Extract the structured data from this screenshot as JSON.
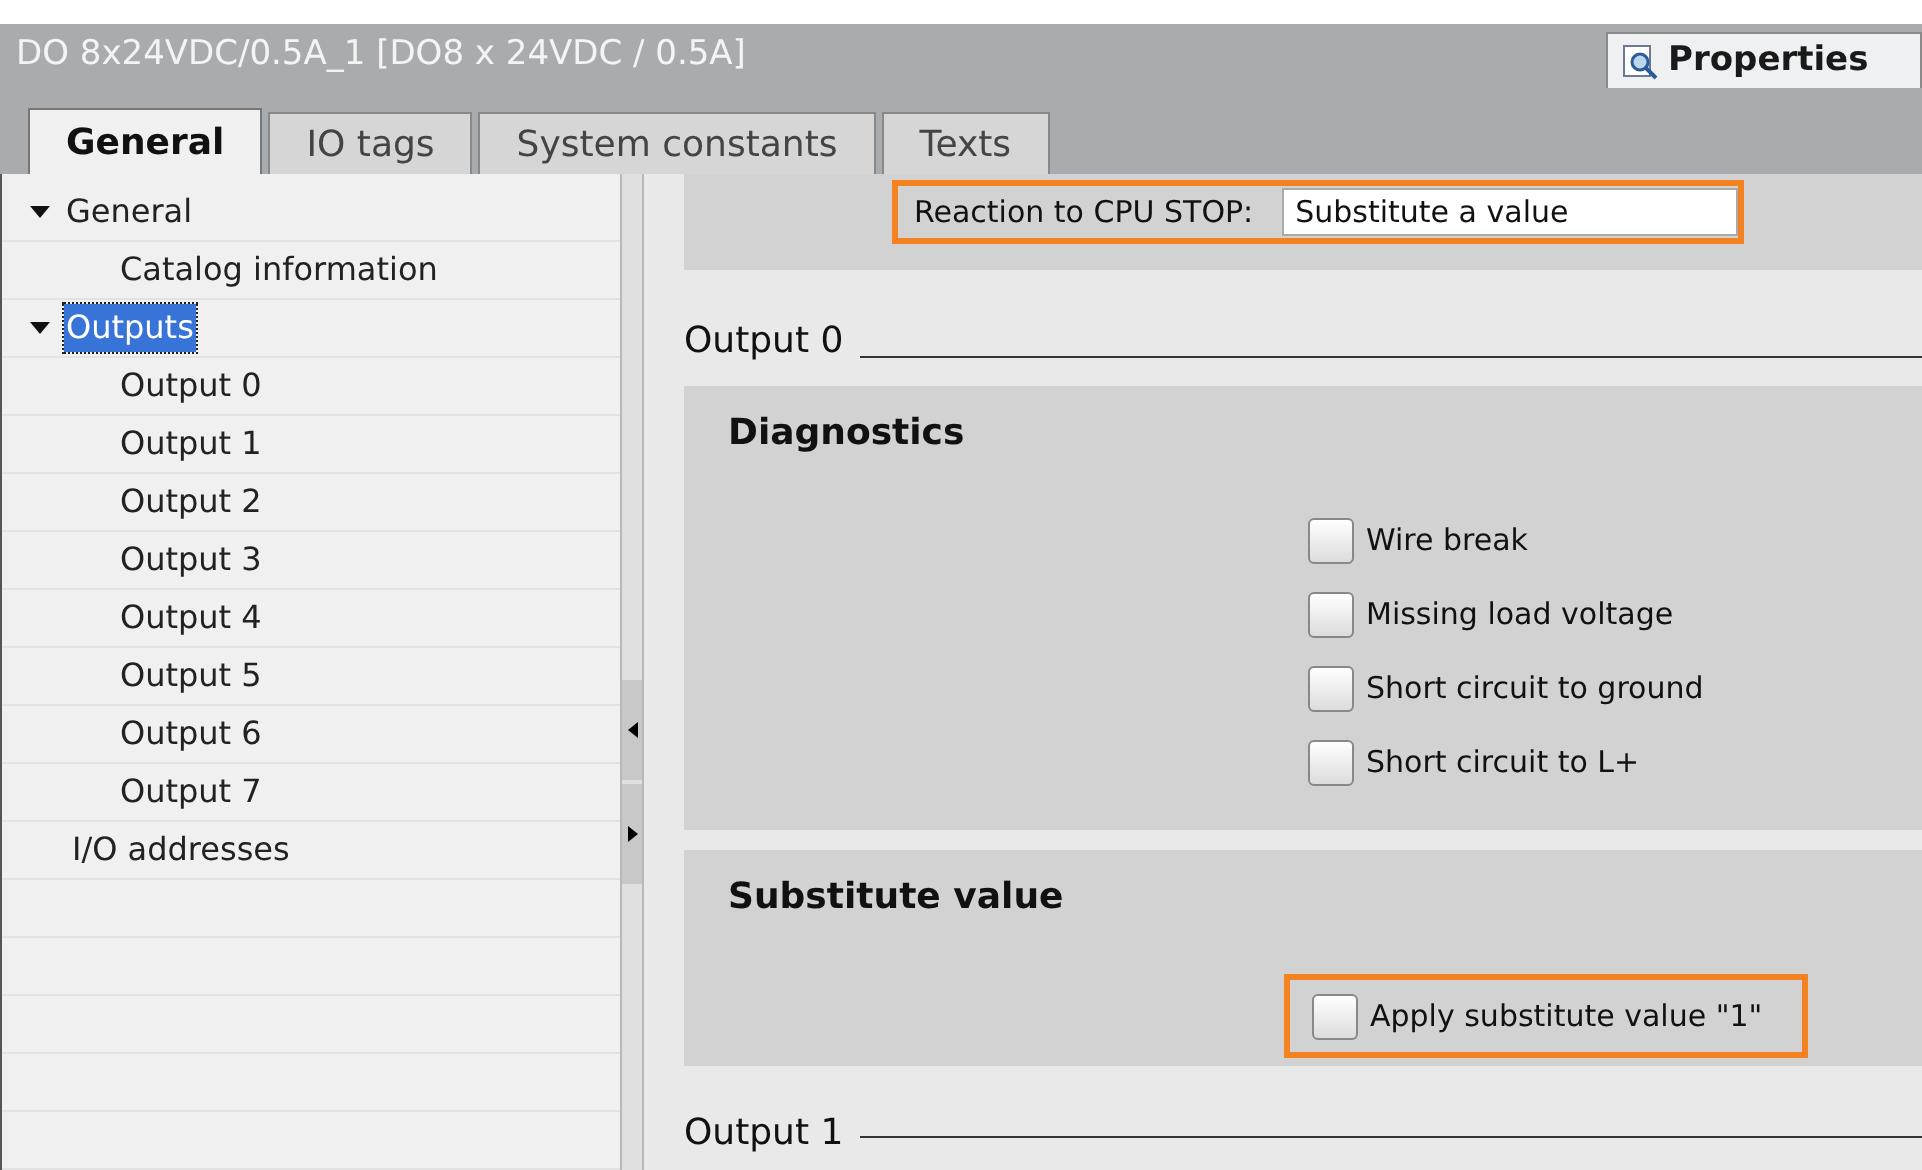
{
  "window": {
    "title": "DO 8x24VDC/0.5A_1 [DO8 x 24VDC / 0.5A]",
    "properties_tab": "Properties"
  },
  "tabs": [
    {
      "label": "General",
      "selected": true
    },
    {
      "label": "IO tags",
      "selected": false
    },
    {
      "label": "System constants",
      "selected": false
    },
    {
      "label": "Texts",
      "selected": false
    }
  ],
  "tree": [
    {
      "label": "General",
      "expanded": true,
      "selected": false,
      "children": [
        {
          "label": "Catalog information",
          "selected": false
        }
      ]
    },
    {
      "label": "Outputs",
      "expanded": true,
      "selected": true,
      "children": [
        {
          "label": "Output 0",
          "selected": false
        },
        {
          "label": "Output 1",
          "selected": false
        },
        {
          "label": "Output 2",
          "selected": false
        },
        {
          "label": "Output 3",
          "selected": false
        },
        {
          "label": "Output 4",
          "selected": false
        },
        {
          "label": "Output 5",
          "selected": false
        },
        {
          "label": "Output 6",
          "selected": false
        },
        {
          "label": "Output 7",
          "selected": false
        }
      ]
    },
    {
      "label": "I/O addresses",
      "selected": false
    }
  ],
  "reaction": {
    "label": "Reaction to CPU STOP:",
    "value": "Substitute a value"
  },
  "output_0": {
    "heading": "Output 0",
    "diagnostics": {
      "title": "Diagnostics",
      "options": [
        {
          "label": "Wire break",
          "checked": false
        },
        {
          "label": "Missing load voltage",
          "checked": false
        },
        {
          "label": "Short circuit to ground",
          "checked": false
        },
        {
          "label": "Short circuit to L+",
          "checked": false
        }
      ]
    },
    "substitute": {
      "title": "Substitute value",
      "options": [
        {
          "label": "Apply substitute value \"1\"",
          "checked": false
        }
      ]
    }
  },
  "output_1": {
    "heading": "Output 1"
  }
}
